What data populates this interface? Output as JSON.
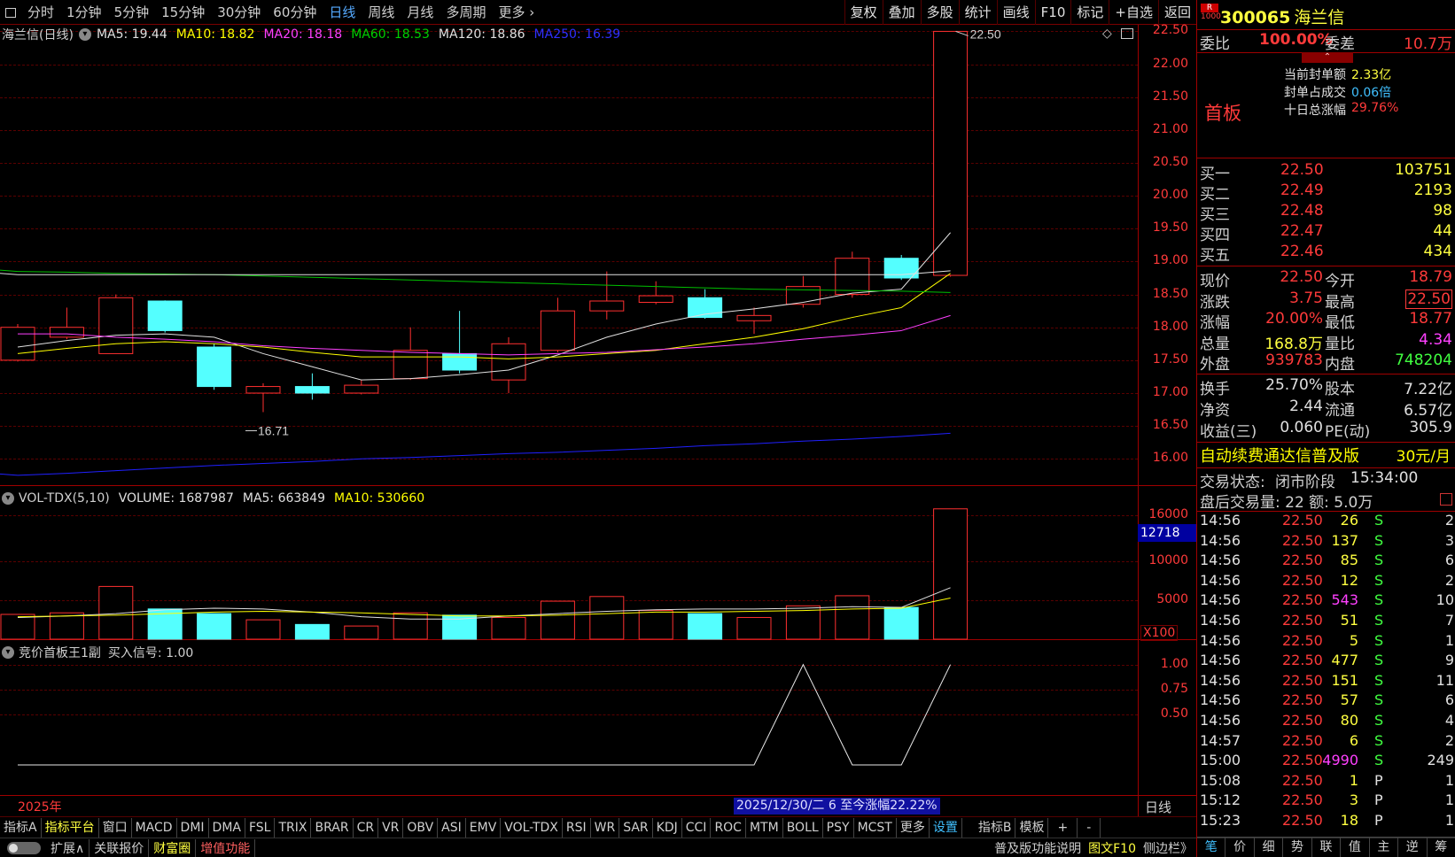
{
  "periods": [
    "分时",
    "1分钟",
    "5分钟",
    "15分钟",
    "30分钟",
    "60分钟",
    "日线",
    "周线",
    "月线",
    "多周期",
    "更多"
  ],
  "active_period": "日线",
  "toolbar": [
    "复权",
    "叠加",
    "多股",
    "统计",
    "画线",
    "F10",
    "标记",
    "+自选",
    "返回"
  ],
  "main_legend": {
    "name": "海兰信(日线)",
    "items": [
      {
        "label": "MA5: 19.44",
        "color": "#e0e0e0"
      },
      {
        "label": "MA10: 18.82",
        "color": "#ffff00"
      },
      {
        "label": "MA20: 18.18",
        "color": "#ff40ff"
      },
      {
        "label": "MA60: 18.53",
        "color": "#00d000"
      },
      {
        "label": "MA120: 18.86",
        "color": "#e0e0e0"
      },
      {
        "label": "MA250: 16.39",
        "color": "#3030ff"
      }
    ]
  },
  "price_axis": [
    "22.50",
    "22.00",
    "21.50",
    "21.00",
    "20.50",
    "20.00",
    "19.50",
    "19.00",
    "18.50",
    "18.00",
    "17.50",
    "17.00",
    "16.50",
    "16.00"
  ],
  "annotations": {
    "high": "22.50",
    "low": "16.71"
  },
  "chart_data": [
    {
      "type": "candlestick",
      "title": "海兰信(日线)",
      "ylim": [
        15.6,
        22.6
      ],
      "candles": [
        {
          "o": 17.5,
          "h": 18.05,
          "l": 17.48,
          "c": 18.0
        },
        {
          "o": 17.85,
          "h": 18.3,
          "l": 17.82,
          "c": 18.0
        },
        {
          "o": 17.6,
          "h": 18.5,
          "l": 17.6,
          "c": 18.45
        },
        {
          "o": 18.4,
          "h": 18.41,
          "l": 17.92,
          "c": 17.95
        },
        {
          "o": 17.7,
          "h": 17.75,
          "l": 17.05,
          "c": 17.1
        },
        {
          "o": 17.0,
          "h": 17.15,
          "l": 16.71,
          "c": 17.1
        },
        {
          "o": 17.1,
          "h": 17.3,
          "l": 16.9,
          "c": 17.0
        },
        {
          "o": 17.0,
          "h": 17.2,
          "l": 16.98,
          "c": 17.12
        },
        {
          "o": 17.22,
          "h": 18.0,
          "l": 17.2,
          "c": 17.65
        },
        {
          "o": 17.6,
          "h": 18.25,
          "l": 17.3,
          "c": 17.35
        },
        {
          "o": 17.2,
          "h": 17.85,
          "l": 17.0,
          "c": 17.75
        },
        {
          "o": 17.65,
          "h": 18.45,
          "l": 17.62,
          "c": 18.25
        },
        {
          "o": 18.25,
          "h": 18.85,
          "l": 18.12,
          "c": 18.4
        },
        {
          "o": 18.38,
          "h": 18.7,
          "l": 18.35,
          "c": 18.48
        },
        {
          "o": 18.45,
          "h": 18.58,
          "l": 18.13,
          "c": 18.15
        },
        {
          "o": 18.1,
          "h": 18.3,
          "l": 17.9,
          "c": 18.18
        },
        {
          "o": 18.35,
          "h": 18.78,
          "l": 18.3,
          "c": 18.62
        },
        {
          "o": 18.5,
          "h": 19.15,
          "l": 18.45,
          "c": 19.05
        },
        {
          "o": 19.05,
          "h": 19.1,
          "l": 18.72,
          "c": 18.75
        },
        {
          "o": 18.79,
          "h": 22.5,
          "l": 18.77,
          "c": 22.5
        }
      ],
      "ma5": [
        17.7,
        17.8,
        17.88,
        17.9,
        17.85,
        17.6,
        17.4,
        17.2,
        17.22,
        17.28,
        17.35,
        17.58,
        17.85,
        18.05,
        18.2,
        18.28,
        18.38,
        18.52,
        18.58,
        19.44
      ],
      "ma10": [
        17.6,
        17.68,
        17.75,
        17.78,
        17.75,
        17.7,
        17.62,
        17.55,
        17.55,
        17.55,
        17.52,
        17.55,
        17.6,
        17.65,
        17.75,
        17.85,
        17.98,
        18.15,
        18.3,
        18.82
      ],
      "ma20": [
        17.9,
        17.9,
        17.85,
        17.82,
        17.78,
        17.72,
        17.68,
        17.65,
        17.62,
        17.6,
        17.58,
        17.6,
        17.62,
        17.66,
        17.7,
        17.75,
        17.82,
        17.88,
        17.95,
        18.18
      ],
      "ma60": [
        18.85,
        18.84,
        18.82,
        18.81,
        18.8,
        18.78,
        18.76,
        18.74,
        18.72,
        18.7,
        18.68,
        18.66,
        18.64,
        18.62,
        18.6,
        18.58,
        18.57,
        18.56,
        18.55,
        18.53
      ],
      "ma120": [
        18.8,
        18.8,
        18.8,
        18.8,
        18.8,
        18.8,
        18.8,
        18.8,
        18.8,
        18.8,
        18.8,
        18.8,
        18.8,
        18.8,
        18.8,
        18.8,
        18.8,
        18.8,
        18.8,
        18.86
      ],
      "ma250": [
        15.75,
        15.78,
        15.82,
        15.86,
        15.9,
        15.93,
        15.96,
        16.0,
        16.02,
        16.05,
        16.08,
        16.1,
        16.13,
        16.16,
        16.2,
        16.23,
        16.27,
        16.3,
        16.34,
        16.39
      ]
    },
    {
      "type": "bar",
      "title": "VOL-TDX(5,10)",
      "values": [
        3200,
        3400,
        6800,
        3900,
        3300,
        2500,
        1900,
        1700,
        3400,
        3100,
        2800,
        4900,
        5500,
        3700,
        3300,
        2800,
        4300,
        5600,
        4100,
        16800
      ],
      "ma5": [
        2800,
        3000,
        3300,
        3800,
        4000,
        3900,
        3500,
        2900,
        2600,
        2600,
        3000,
        3300,
        3600,
        3800,
        3900,
        3900,
        4000,
        4200,
        4100,
        6639
      ],
      "ma10": [
        2900,
        3000,
        3100,
        3300,
        3500,
        3600,
        3500,
        3400,
        3200,
        3000,
        3000,
        3100,
        3300,
        3500,
        3500,
        3600,
        3700,
        3900,
        4000,
        5307
      ],
      "ylim": [
        0,
        17000
      ],
      "axis": [
        "16000",
        "10000",
        "5000"
      ],
      "unit": "X100"
    },
    {
      "type": "line",
      "title": "竞价首板王1副",
      "values": [
        0,
        0,
        0,
        0,
        0,
        0,
        0,
        0,
        0,
        0,
        0,
        0,
        0,
        0,
        0,
        0,
        1,
        0,
        0,
        1
      ],
      "ylim": [
        -0.3,
        1.05
      ],
      "axis": [
        "1.00",
        "0.75",
        "0.50"
      ]
    }
  ],
  "vol_legend": {
    "name": "VOL-TDX(5,10)",
    "items": [
      {
        "label": "VOLUME: 1687987",
        "color": "#e0e0e0"
      },
      {
        "label": "MA5: 663849",
        "color": "#e0e0e0"
      },
      {
        "label": "MA10: 530660",
        "color": "#ffff00"
      }
    ]
  },
  "vol_current": "12718",
  "ind_legend": {
    "name": "竞价首板王1副",
    "signal": "买入信号: 1.00"
  },
  "time_label": "2025年",
  "range_info": "2025/12/30/二 6 至今涨幅22.22%",
  "period_right": "日线",
  "indicators": [
    "指标A",
    "指标平台",
    "窗口",
    "MACD",
    "DMI",
    "DMA",
    "FSL",
    "TRIX",
    "BRAR",
    "CR",
    "VR",
    "OBV",
    "ASI",
    "EMV",
    "VOL-TDX",
    "RSI",
    "WR",
    "SAR",
    "KDJ",
    "CCI",
    "ROC",
    "MTM",
    "BOLL",
    "PSY",
    "MCST",
    "更多",
    "设置",
    "指标B",
    "模板",
    "+",
    "-"
  ],
  "status_items": [
    "扩展∧",
    "关联报价",
    "财富圈",
    "增值功能"
  ],
  "status_right": [
    "普及版功能说明",
    "图文F10",
    "侧边栏》"
  ],
  "stock": {
    "code": "300065",
    "name": "海兰信",
    "badge_top": "R",
    "badge_bottom": "1000"
  },
  "weibi": {
    "l1": "委比",
    "v1": "100.00%",
    "l2": "委差",
    "v2": "10.7万"
  },
  "board": {
    "tag": "首板",
    "rows": [
      {
        "label": "当前封单额",
        "value": "2.33亿"
      },
      {
        "label": "封单占成交",
        "value": "0.06倍"
      },
      {
        "label": "十日总涨幅",
        "value": "29.76%"
      }
    ]
  },
  "bids": [
    {
      "label": "买一",
      "price": "22.50",
      "vol": "103751"
    },
    {
      "label": "买二",
      "price": "22.49",
      "vol": "2193"
    },
    {
      "label": "买三",
      "price": "22.48",
      "vol": "98"
    },
    {
      "label": "买四",
      "price": "22.47",
      "vol": "44"
    },
    {
      "label": "买五",
      "price": "22.46",
      "vol": "434"
    }
  ],
  "quote": [
    {
      "l1": "现价",
      "v1": "22.50",
      "l2": "今开",
      "v2": "18.79"
    },
    {
      "l1": "涨跌",
      "v1": "3.75",
      "l2": "最高",
      "v2": "22.50"
    },
    {
      "l1": "涨幅",
      "v1": "20.00%",
      "l2": "最低",
      "v2": "18.77"
    },
    {
      "l1": "总量",
      "v1": "168.8万",
      "l2": "量比",
      "v2": "4.34"
    },
    {
      "l1": "外盘",
      "v1": "939783",
      "l2": "内盘",
      "v2": "748204"
    }
  ],
  "fund": [
    {
      "l1": "换手",
      "v1": "25.70%",
      "l2": "股本",
      "v2": "7.22亿"
    },
    {
      "l1": "净资",
      "v1": "2.44",
      "l2": "流通",
      "v2": "6.57亿"
    },
    {
      "l1": "收益(三)",
      "v1": "0.060",
      "l2": "PE(动)",
      "v2": "305.9"
    }
  ],
  "promo": {
    "text": "自动续费通达信普及版",
    "price": "30元/月"
  },
  "trade_status": {
    "label": "交易状态:",
    "value": "闭市阶段",
    "time": "15:34:00"
  },
  "after_hours": "盘后交易量: 22  额: 5.0万",
  "ticks": [
    {
      "t": "14:56",
      "p": "22.50",
      "v": "26",
      "s": "S",
      "n": "2"
    },
    {
      "t": "14:56",
      "p": "22.50",
      "v": "137",
      "s": "S",
      "n": "3"
    },
    {
      "t": "14:56",
      "p": "22.50",
      "v": "85",
      "s": "S",
      "n": "6"
    },
    {
      "t": "14:56",
      "p": "22.50",
      "v": "12",
      "s": "S",
      "n": "2"
    },
    {
      "t": "14:56",
      "p": "22.50",
      "v": "543",
      "s": "S",
      "n": "10"
    },
    {
      "t": "14:56",
      "p": "22.50",
      "v": "51",
      "s": "S",
      "n": "7"
    },
    {
      "t": "14:56",
      "p": "22.50",
      "v": "5",
      "s": "S",
      "n": "1"
    },
    {
      "t": "14:56",
      "p": "22.50",
      "v": "477",
      "s": "S",
      "n": "9"
    },
    {
      "t": "14:56",
      "p": "22.50",
      "v": "151",
      "s": "S",
      "n": "11"
    },
    {
      "t": "14:56",
      "p": "22.50",
      "v": "57",
      "s": "S",
      "n": "6"
    },
    {
      "t": "14:56",
      "p": "22.50",
      "v": "80",
      "s": "S",
      "n": "4"
    },
    {
      "t": "14:57",
      "p": "22.50",
      "v": "6",
      "s": "S",
      "n": "2"
    },
    {
      "t": "15:00",
      "p": "22.50",
      "v": "4990",
      "s": "S",
      "n": "249"
    },
    {
      "t": "15:08",
      "p": "22.50",
      "v": "1",
      "s": "P",
      "n": "1"
    },
    {
      "t": "15:12",
      "p": "22.50",
      "v": "3",
      "s": "P",
      "n": "1"
    },
    {
      "t": "15:23",
      "p": "22.50",
      "v": "18",
      "s": "P",
      "n": "1"
    }
  ],
  "bottom_tabs": [
    "笔",
    "价",
    "细",
    "势",
    "联",
    "值",
    "主",
    "逆",
    "筹"
  ]
}
